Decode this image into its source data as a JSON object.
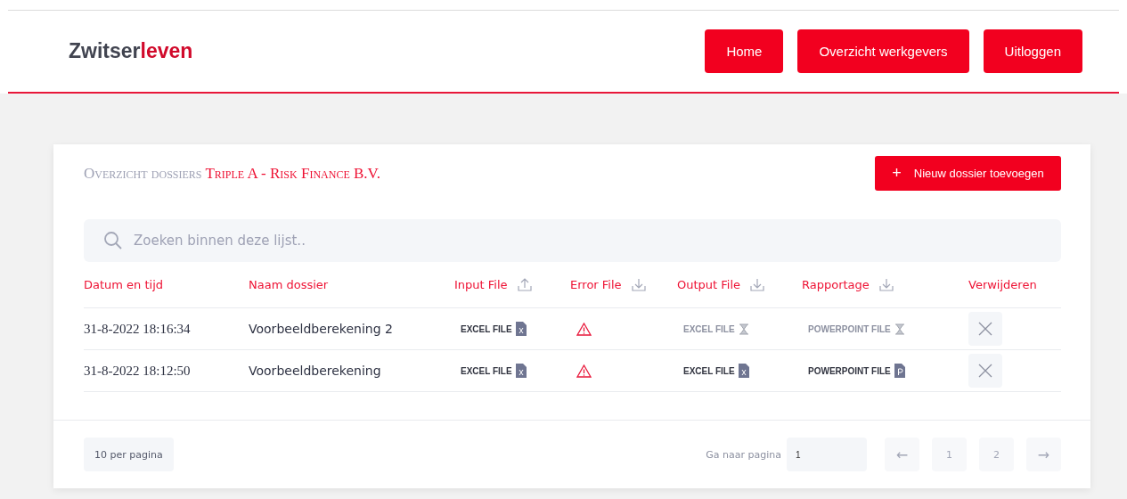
{
  "header": {
    "logo": {
      "text": "Zwitser",
      "accent": "leven"
    },
    "nav": [
      "Home",
      "Overzicht werkgevers",
      "Uitloggen"
    ]
  },
  "panel": {
    "title": "Overzicht dossiers",
    "client": "Triple A - Risk Finance B.V.",
    "add_button": {
      "icon": "+",
      "label": "Nieuw dossier toevoegen"
    },
    "search": {
      "placeholder": "Zoeken binnen deze lijst.."
    },
    "table": {
      "columns": [
        {
          "label": "Datum en tijd",
          "kind": "plain"
        },
        {
          "label": "Naam dossier",
          "kind": "plain"
        },
        {
          "label": "Input File",
          "kind": "upload"
        },
        {
          "label": "Error File",
          "kind": "download"
        },
        {
          "label": "Output File",
          "kind": "download"
        },
        {
          "label": "Rapportage",
          "kind": "download"
        },
        {
          "label": "Verwijderen",
          "kind": "plain"
        }
      ],
      "rows": [
        {
          "date": "31-8-2022 18:16:34",
          "name": "Voorbeeldberekening 2",
          "input": {
            "label": "EXCEL FILE",
            "kind": "excel",
            "pending": false
          },
          "error": true,
          "output": {
            "label": "EXCEL FILE",
            "pending": true
          },
          "report": {
            "label": "POWERPOINT FILE",
            "pending": true
          }
        },
        {
          "date": "31-8-2022 18:12:50",
          "name": "Voorbeeldberekening",
          "input": {
            "label": "EXCEL FILE",
            "kind": "excel",
            "pending": false
          },
          "error": true,
          "output": {
            "label": "EXCEL FILE",
            "kind": "excel",
            "pending": false
          },
          "report": {
            "label": "POWERPOINT FILE",
            "kind": "powerpoint",
            "pending": false
          }
        }
      ]
    },
    "footer": {
      "page_size": "10 per pagina",
      "goto_label": "Ga naar pagina",
      "goto_value": "1",
      "prev": "←",
      "pages": [
        "1",
        "2"
      ],
      "next": "→"
    }
  }
}
